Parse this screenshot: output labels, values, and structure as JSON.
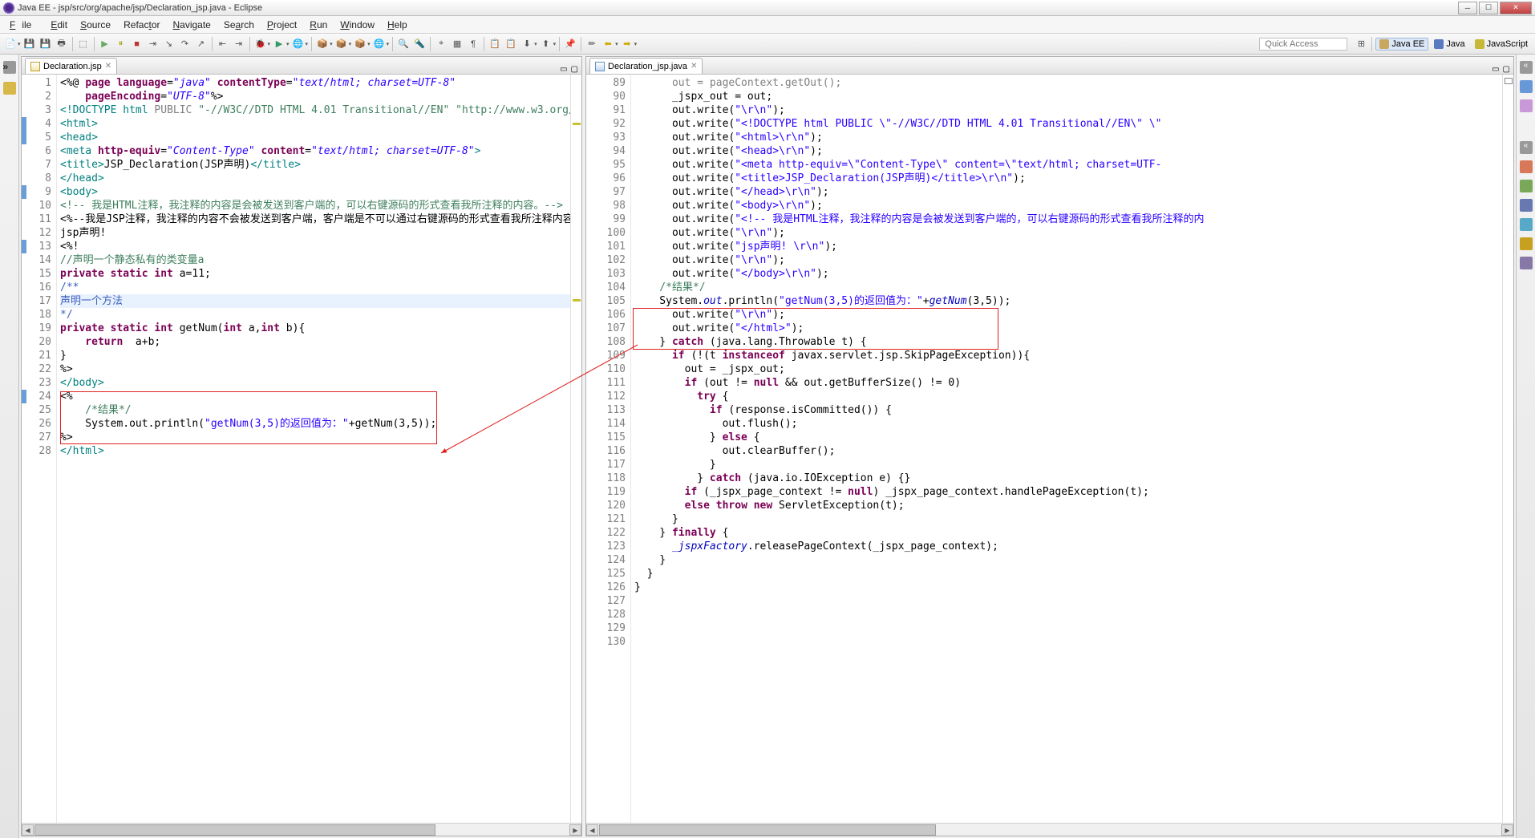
{
  "title": "Java EE - jsp/src/org/apache/jsp/Declaration_jsp.java - Eclipse",
  "menu": {
    "file": "File",
    "edit": "Edit",
    "source": "Source",
    "refactor": "Refactor",
    "navigate": "Navigate",
    "search": "Search",
    "project": "Project",
    "run": "Run",
    "window": "Window",
    "help": "Help"
  },
  "quick_access": "Quick Access",
  "perspectives": {
    "javaee": "Java EE",
    "java": "Java",
    "js": "JavaScript"
  },
  "tabs": {
    "left": "Declaration.jsp",
    "right": "Declaration_jsp.java"
  },
  "left_code": {
    "lines": [
      {
        "n": 1,
        "segs": [
          {
            "t": "<%@ ",
            "c": "k-black"
          },
          {
            "t": "page",
            "c": "k-kw"
          },
          {
            "t": " language",
            "c": "k-attr"
          },
          {
            "t": "=",
            "c": "k-black"
          },
          {
            "t": "\"java\"",
            "c": "k-strit"
          },
          {
            "t": " contentType",
            "c": "k-attr"
          },
          {
            "t": "=",
            "c": "k-black"
          },
          {
            "t": "\"text/html; charset=UTF-8\"",
            "c": "k-strit"
          }
        ]
      },
      {
        "n": 2,
        "segs": [
          {
            "t": "    pageEncoding",
            "c": "k-attr"
          },
          {
            "t": "=",
            "c": "k-black"
          },
          {
            "t": "\"UTF-8\"",
            "c": "k-strit"
          },
          {
            "t": "%>",
            "c": "k-black"
          }
        ]
      },
      {
        "n": 3,
        "segs": [
          {
            "t": "<!DOCTYPE ",
            "c": "k-tag"
          },
          {
            "t": "html ",
            "c": "k-tag"
          },
          {
            "t": "PUBLIC ",
            "c": "k-doctype"
          },
          {
            "t": "\"-//W3C//DTD HTML 4.01 Transitional//EN\"",
            "c": "k-cmt"
          },
          {
            "t": " ",
            "c": "k-black"
          },
          {
            "t": "\"http://www.w3.org/T",
            "c": "k-cmt"
          }
        ]
      },
      {
        "n": 4,
        "mark": true,
        "segs": [
          {
            "t": "<html>",
            "c": "k-tag"
          }
        ]
      },
      {
        "n": 5,
        "mark": true,
        "segs": [
          {
            "t": "<head>",
            "c": "k-tag"
          }
        ]
      },
      {
        "n": 6,
        "segs": [
          {
            "t": "<meta ",
            "c": "k-tag"
          },
          {
            "t": "http-equiv",
            "c": "k-attr"
          },
          {
            "t": "=",
            "c": "k-black"
          },
          {
            "t": "\"Content-Type\"",
            "c": "k-strit"
          },
          {
            "t": " content",
            "c": "k-attr"
          },
          {
            "t": "=",
            "c": "k-black"
          },
          {
            "t": "\"text/html; charset=UTF-8\"",
            "c": "k-strit"
          },
          {
            "t": ">",
            "c": "k-tag"
          }
        ]
      },
      {
        "n": 7,
        "segs": [
          {
            "t": "<title>",
            "c": "k-tag"
          },
          {
            "t": "JSP_Declaration(JSP声明)",
            "c": "k-black"
          },
          {
            "t": "</title>",
            "c": "k-tag"
          }
        ]
      },
      {
        "n": 8,
        "segs": [
          {
            "t": "</head>",
            "c": "k-tag"
          }
        ]
      },
      {
        "n": 9,
        "mark": true,
        "segs": [
          {
            "t": "<body>",
            "c": "k-tag"
          }
        ]
      },
      {
        "n": 10,
        "segs": [
          {
            "t": "<!-- 我是HTML注释，我注释的内容是会被发送到客户端的，可以右键源码的形式查看我所注释的内容。-->",
            "c": "k-cmt"
          }
        ]
      },
      {
        "n": 11,
        "segs": [
          {
            "t": "<%--我是JSP注释，我注释的内容不会被发送到客户端，客户端是不可以通过右键源码的形式查看我所注释内容的。--%>",
            "c": "k-black"
          }
        ]
      },
      {
        "n": 12,
        "segs": [
          {
            "t": "jsp声明!",
            "c": "k-black"
          }
        ]
      },
      {
        "n": 13,
        "mark": true,
        "segs": [
          {
            "t": "<%!",
            "c": "k-black"
          }
        ]
      },
      {
        "n": 14,
        "segs": [
          {
            "t": "//声明一个静态私有的类变量a",
            "c": "k-cmt"
          }
        ]
      },
      {
        "n": 15,
        "segs": [
          {
            "t": "private static int ",
            "c": "k-kw"
          },
          {
            "t": "a=11;",
            "c": "k-black"
          }
        ]
      },
      {
        "n": 16,
        "segs": [
          {
            "t": "/**",
            "c": "k-cmt2"
          }
        ]
      },
      {
        "n": 17,
        "hl": true,
        "segs": [
          {
            "t": "声明一个方法",
            "c": "k-cmt2"
          }
        ]
      },
      {
        "n": 18,
        "segs": [
          {
            "t": "*/",
            "c": "k-cmt2"
          }
        ]
      },
      {
        "n": 19,
        "segs": [
          {
            "t": "private static int ",
            "c": "k-kw"
          },
          {
            "t": "getNum(",
            "c": "k-black"
          },
          {
            "t": "int ",
            "c": "k-kw"
          },
          {
            "t": "a,",
            "c": "k-black"
          },
          {
            "t": "int ",
            "c": "k-kw"
          },
          {
            "t": "b){",
            "c": "k-black"
          }
        ]
      },
      {
        "n": 20,
        "segs": [
          {
            "t": "    return  ",
            "c": "k-kw"
          },
          {
            "t": "a+b;",
            "c": "k-black"
          }
        ]
      },
      {
        "n": 21,
        "segs": [
          {
            "t": "}",
            "c": "k-black"
          }
        ]
      },
      {
        "n": 22,
        "segs": [
          {
            "t": "%>",
            "c": "k-black"
          }
        ]
      },
      {
        "n": 23,
        "segs": [
          {
            "t": "</body>",
            "c": "k-tag"
          }
        ]
      },
      {
        "n": 24,
        "mark": true,
        "segs": [
          {
            "t": "<%",
            "c": "k-black"
          }
        ]
      },
      {
        "n": 25,
        "segs": [
          {
            "t": "    /*结果*/",
            "c": "k-cmt"
          }
        ]
      },
      {
        "n": 26,
        "segs": [
          {
            "t": "    System.out.println(",
            "c": "k-black"
          },
          {
            "t": "\"getNum(3,5)的返回值为：\"",
            "c": "k-str"
          },
          {
            "t": "+getNum(3,5));",
            "c": "k-black"
          }
        ]
      },
      {
        "n": 27,
        "segs": [
          {
            "t": "%>",
            "c": "k-black"
          }
        ]
      },
      {
        "n": 28,
        "segs": [
          {
            "t": "</html>",
            "c": "k-tag"
          }
        ]
      }
    ]
  },
  "right_code": {
    "start": 89,
    "lines": [
      {
        "n": 89,
        "segs": [
          {
            "t": "      out = pageContext.getOut();",
            "c": "k-doctype"
          }
        ]
      },
      {
        "n": 90,
        "segs": [
          {
            "t": "      _jspx_out = out;",
            "c": "k-black"
          }
        ]
      },
      {
        "n": 91,
        "segs": [
          {
            "t": "",
            "c": "k-black"
          }
        ]
      },
      {
        "n": 92,
        "segs": [
          {
            "t": "      out.write(",
            "c": "k-black"
          },
          {
            "t": "\"\\r\\n\"",
            "c": "k-str"
          },
          {
            "t": ");",
            "c": "k-black"
          }
        ]
      },
      {
        "n": 93,
        "segs": [
          {
            "t": "      out.write(",
            "c": "k-black"
          },
          {
            "t": "\"<!DOCTYPE html PUBLIC \\\"-//W3C//DTD HTML 4.01 Transitional//EN\\\" \\\"",
            "c": "k-str"
          }
        ]
      },
      {
        "n": 94,
        "segs": [
          {
            "t": "      out.write(",
            "c": "k-black"
          },
          {
            "t": "\"<html>\\r\\n\"",
            "c": "k-str"
          },
          {
            "t": ");",
            "c": "k-black"
          }
        ]
      },
      {
        "n": 95,
        "segs": [
          {
            "t": "      out.write(",
            "c": "k-black"
          },
          {
            "t": "\"<head>\\r\\n\"",
            "c": "k-str"
          },
          {
            "t": ");",
            "c": "k-black"
          }
        ]
      },
      {
        "n": 96,
        "segs": [
          {
            "t": "      out.write(",
            "c": "k-black"
          },
          {
            "t": "\"<meta http-equiv=\\\"Content-Type\\\" content=\\\"text/html; charset=UTF-",
            "c": "k-str"
          }
        ]
      },
      {
        "n": 97,
        "segs": [
          {
            "t": "      out.write(",
            "c": "k-black"
          },
          {
            "t": "\"<title>JSP_Declaration(JSP声明)</title>\\r\\n\"",
            "c": "k-str"
          },
          {
            "t": ");",
            "c": "k-black"
          }
        ]
      },
      {
        "n": 98,
        "segs": [
          {
            "t": "      out.write(",
            "c": "k-black"
          },
          {
            "t": "\"</head>\\r\\n\"",
            "c": "k-str"
          },
          {
            "t": ");",
            "c": "k-black"
          }
        ]
      },
      {
        "n": 99,
        "segs": [
          {
            "t": "      out.write(",
            "c": "k-black"
          },
          {
            "t": "\"<body>\\r\\n\"",
            "c": "k-str"
          },
          {
            "t": ");",
            "c": "k-black"
          }
        ]
      },
      {
        "n": 100,
        "segs": [
          {
            "t": "      out.write(",
            "c": "k-black"
          },
          {
            "t": "\"<!-- 我是HTML注释，我注释的内容是会被发送到客户端的，可以右键源码的形式查看我所注释的内",
            "c": "k-str"
          }
        ]
      },
      {
        "n": 101,
        "segs": [
          {
            "t": "      out.write(",
            "c": "k-black"
          },
          {
            "t": "\"\\r\\n\"",
            "c": "k-str"
          },
          {
            "t": ");",
            "c": "k-black"
          }
        ]
      },
      {
        "n": 102,
        "segs": [
          {
            "t": "      out.write(",
            "c": "k-black"
          },
          {
            "t": "\"jsp声明! \\r\\n\"",
            "c": "k-str"
          },
          {
            "t": ");",
            "c": "k-black"
          }
        ]
      },
      {
        "n": 103,
        "segs": [
          {
            "t": "      out.write(",
            "c": "k-black"
          },
          {
            "t": "\"\\r\\n\"",
            "c": "k-str"
          },
          {
            "t": ");",
            "c": "k-black"
          }
        ]
      },
      {
        "n": 104,
        "segs": [
          {
            "t": "      out.write(",
            "c": "k-black"
          },
          {
            "t": "\"</body>\\r\\n\"",
            "c": "k-str"
          },
          {
            "t": ");",
            "c": "k-black"
          }
        ]
      },
      {
        "n": 105,
        "segs": [
          {
            "t": "",
            "c": "k-black"
          }
        ]
      },
      {
        "n": 106,
        "segs": [
          {
            "t": "    /*结果*/",
            "c": "k-cmt"
          }
        ]
      },
      {
        "n": 107,
        "segs": [
          {
            "t": "    System.",
            "c": "k-black"
          },
          {
            "t": "out",
            "c": "k-fld"
          },
          {
            "t": ".println(",
            "c": "k-black"
          },
          {
            "t": "\"getNum(3,5)的返回值为：\"",
            "c": "k-str"
          },
          {
            "t": "+",
            "c": "k-black"
          },
          {
            "t": "getNum",
            "c": "k-fld"
          },
          {
            "t": "(3,5));",
            "c": "k-black"
          }
        ]
      },
      {
        "n": 108,
        "segs": [
          {
            "t": "",
            "c": "k-black"
          }
        ]
      },
      {
        "n": 109,
        "segs": [
          {
            "t": "      out.write(",
            "c": "k-black"
          },
          {
            "t": "\"\\r\\n\"",
            "c": "k-str"
          },
          {
            "t": ");",
            "c": "k-black"
          }
        ]
      },
      {
        "n": 110,
        "segs": [
          {
            "t": "      out.write(",
            "c": "k-black"
          },
          {
            "t": "\"</html>\"",
            "c": "k-str"
          },
          {
            "t": ");",
            "c": "k-black"
          }
        ]
      },
      {
        "n": 111,
        "segs": [
          {
            "t": "    } ",
            "c": "k-black"
          },
          {
            "t": "catch",
            "c": "k-kw"
          },
          {
            "t": " (java.lang.Throwable t) {",
            "c": "k-black"
          }
        ]
      },
      {
        "n": 112,
        "segs": [
          {
            "t": "      ",
            "c": "k-black"
          },
          {
            "t": "if",
            "c": "k-kw"
          },
          {
            "t": " (!(t ",
            "c": "k-black"
          },
          {
            "t": "instanceof",
            "c": "k-kw"
          },
          {
            "t": " javax.servlet.jsp.SkipPageException)){",
            "c": "k-black"
          }
        ]
      },
      {
        "n": 113,
        "segs": [
          {
            "t": "        out = _jspx_out;",
            "c": "k-black"
          }
        ]
      },
      {
        "n": 114,
        "segs": [
          {
            "t": "        ",
            "c": "k-black"
          },
          {
            "t": "if",
            "c": "k-kw"
          },
          {
            "t": " (out != ",
            "c": "k-black"
          },
          {
            "t": "null",
            "c": "k-kw"
          },
          {
            "t": " && out.getBufferSize() != 0)",
            "c": "k-black"
          }
        ]
      },
      {
        "n": 115,
        "segs": [
          {
            "t": "          ",
            "c": "k-black"
          },
          {
            "t": "try",
            "c": "k-kw"
          },
          {
            "t": " {",
            "c": "k-black"
          }
        ]
      },
      {
        "n": 116,
        "segs": [
          {
            "t": "            ",
            "c": "k-black"
          },
          {
            "t": "if",
            "c": "k-kw"
          },
          {
            "t": " (response.isCommitted()) {",
            "c": "k-black"
          }
        ]
      },
      {
        "n": 117,
        "segs": [
          {
            "t": "              out.flush();",
            "c": "k-black"
          }
        ]
      },
      {
        "n": 118,
        "segs": [
          {
            "t": "            } ",
            "c": "k-black"
          },
          {
            "t": "else",
            "c": "k-kw"
          },
          {
            "t": " {",
            "c": "k-black"
          }
        ]
      },
      {
        "n": 119,
        "segs": [
          {
            "t": "              out.clearBuffer();",
            "c": "k-black"
          }
        ]
      },
      {
        "n": 120,
        "segs": [
          {
            "t": "            }",
            "c": "k-black"
          }
        ]
      },
      {
        "n": 121,
        "segs": [
          {
            "t": "          } ",
            "c": "k-black"
          },
          {
            "t": "catch",
            "c": "k-kw"
          },
          {
            "t": " (java.io.IOException e) {}",
            "c": "k-black"
          }
        ]
      },
      {
        "n": 122,
        "segs": [
          {
            "t": "        ",
            "c": "k-black"
          },
          {
            "t": "if",
            "c": "k-kw"
          },
          {
            "t": " (_jspx_page_context != ",
            "c": "k-black"
          },
          {
            "t": "null",
            "c": "k-kw"
          },
          {
            "t": ") _jspx_page_context.handlePageException(t);",
            "c": "k-black"
          }
        ]
      },
      {
        "n": 123,
        "segs": [
          {
            "t": "        ",
            "c": "k-black"
          },
          {
            "t": "else throw new",
            "c": "k-kw"
          },
          {
            "t": " ServletException(t);",
            "c": "k-black"
          }
        ]
      },
      {
        "n": 124,
        "segs": [
          {
            "t": "      }",
            "c": "k-black"
          }
        ]
      },
      {
        "n": 125,
        "segs": [
          {
            "t": "    } ",
            "c": "k-black"
          },
          {
            "t": "finally",
            "c": "k-kw"
          },
          {
            "t": " {",
            "c": "k-black"
          }
        ]
      },
      {
        "n": 126,
        "segs": [
          {
            "t": "      ",
            "c": "k-black"
          },
          {
            "t": "_jspxFactory",
            "c": "k-fld"
          },
          {
            "t": ".releasePageContext(_jspx_page_context);",
            "c": "k-black"
          }
        ]
      },
      {
        "n": 127,
        "segs": [
          {
            "t": "    }",
            "c": "k-black"
          }
        ]
      },
      {
        "n": 128,
        "segs": [
          {
            "t": "  }",
            "c": "k-black"
          }
        ]
      },
      {
        "n": 129,
        "segs": [
          {
            "t": "}",
            "c": "k-black"
          }
        ]
      },
      {
        "n": 130,
        "segs": [
          {
            "t": "",
            "c": "k-black"
          }
        ]
      }
    ]
  }
}
